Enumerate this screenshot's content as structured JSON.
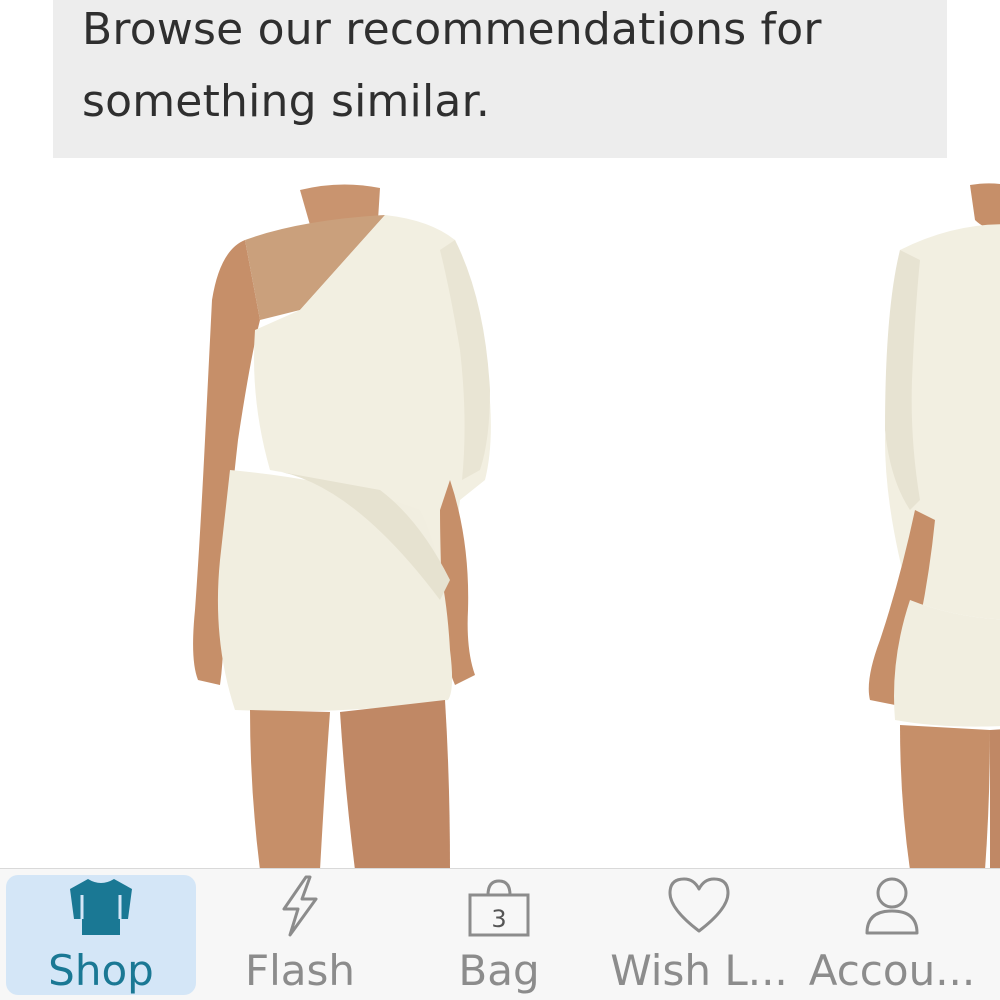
{
  "notice": {
    "line1": "Browse our recommendations for",
    "line2": "something similar."
  },
  "carousel": {
    "items": [
      {
        "icon": "product-dress-photo"
      },
      {
        "icon": "product-dress-photo"
      }
    ]
  },
  "tabbar": {
    "tabs": [
      {
        "label": "Shop",
        "icon": "shirt-icon",
        "active": true
      },
      {
        "label": "Flash",
        "icon": "lightning-icon",
        "active": false
      },
      {
        "label": "Bag",
        "icon": "bag-icon",
        "count": "3",
        "active": false
      },
      {
        "label": "Wish L...",
        "icon": "heart-icon",
        "active": false
      },
      {
        "label": "Accou...",
        "icon": "person-icon",
        "active": false
      }
    ]
  },
  "colors": {
    "accent": "#1a7894",
    "active_tab_bg": "#d4e6f7",
    "inactive_text": "#8c8c8c",
    "notice_bg": "#ededed"
  }
}
